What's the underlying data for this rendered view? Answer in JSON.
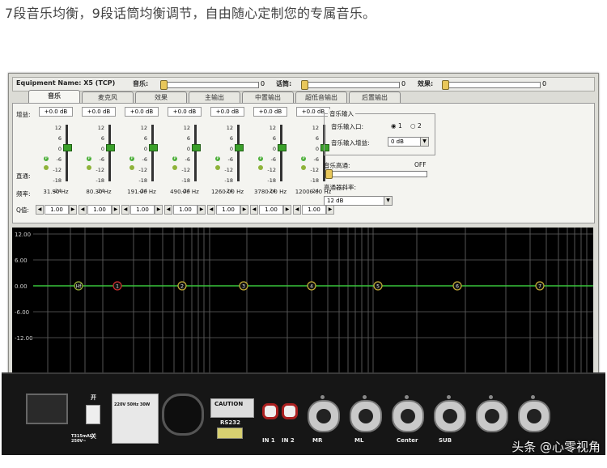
{
  "headline": "7段音乐均衡，9段话筒均衡调节，自由随心定制您的专属音乐。",
  "topbar": {
    "equipment": "Equipment Name: X5 (TCP)",
    "music_label": "音乐:",
    "music_value": "0",
    "mic_label": "话筒:",
    "mic_value": "0",
    "effect_label": "效果:",
    "effect_value": "0"
  },
  "tabs": [
    "音乐",
    "麦克风",
    "效果",
    "主输出",
    "中置输出",
    "超低音输出",
    "后置输出"
  ],
  "panel": {
    "gain_label": "增益:",
    "bypass_label": "直通:",
    "freq_label": "频率:",
    "q_label": "Q值:",
    "bands": [
      {
        "gain": "+0.0 dB",
        "freq": "31.90 Hz",
        "q": "1.00"
      },
      {
        "gain": "+0.0 dB",
        "freq": "80.30 Hz",
        "q": "1.00"
      },
      {
        "gain": "+0.0 dB",
        "freq": "191.00 Hz",
        "q": "1.00"
      },
      {
        "gain": "+0.0 dB",
        "freq": "490.00 Hz",
        "q": "1.00"
      },
      {
        "gain": "+0.0 dB",
        "freq": "1260.00 Hz",
        "q": "1.00"
      },
      {
        "gain": "+0.0 dB",
        "freq": "3780.00 Hz",
        "q": "1.00"
      },
      {
        "gain": "+0.0 dB",
        "freq": "12000.00 Hz",
        "q": "1.00"
      }
    ],
    "scale": [
      "12",
      "6",
      "0",
      "-6",
      "-12",
      "-18",
      "-24"
    ],
    "music_input": {
      "title": "音乐输入",
      "input_label": "音乐输入口:",
      "opt1": "1",
      "opt2": "2",
      "gain_label": "音乐输入增益:",
      "gain_value": "0 dB"
    },
    "music_bypass": {
      "label": "音乐高通:",
      "state": "OFF"
    },
    "limiter": {
      "label": "高通器斜率:",
      "value": "12 dB"
    }
  },
  "graph": {
    "y_ticks": [
      "12.00",
      "6.00",
      "0.00",
      "-6.00",
      "-12.00"
    ],
    "points": [
      "Hf",
      "1",
      "2",
      "3",
      "4",
      "5",
      "6",
      "7"
    ]
  },
  "device": {
    "switch_on": "开",
    "switch_off": "关",
    "fuse": "T315mAL 250V~",
    "rating": "220V 50Hz 30W",
    "caution": "CAUTION",
    "rs232": "RS232",
    "in1": "IN 1",
    "in2": "IN 2",
    "outs": [
      "MR",
      "ML",
      "Center",
      "SUB",
      "",
      ""
    ]
  },
  "watermark": "头条 @心零视角"
}
